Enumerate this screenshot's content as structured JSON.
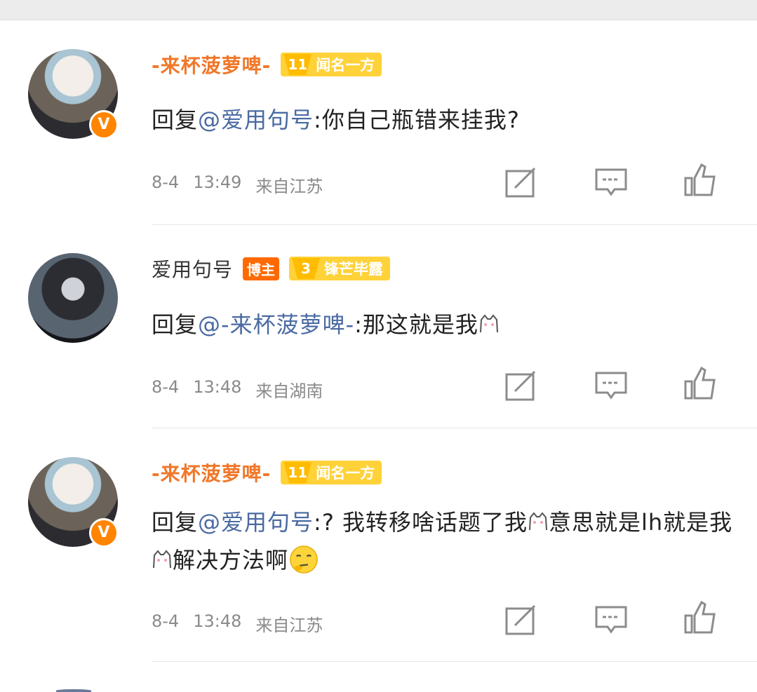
{
  "comments": [
    {
      "username": "-来杯菠萝啤-",
      "level": "11",
      "level_name": "闻名一方",
      "host_tag": "",
      "verified_badge": "V",
      "reply_prefix": "回复",
      "mention": "@爱用句号",
      "text": ":你自己瓶错来挂我?",
      "date": "8-4",
      "time": "13:49",
      "location": "来自江苏"
    },
    {
      "username": "爱用句号",
      "level": "3",
      "level_name": "锋芒毕露",
      "host_tag": "博主",
      "verified_badge": "",
      "reply_prefix": "回复",
      "mention": "@-来杯菠萝啤-",
      "text": ":那这就是我",
      "date": "8-4",
      "time": "13:48",
      "location": "来自湖南"
    },
    {
      "username": "-来杯菠萝啤-",
      "level": "11",
      "level_name": "闻名一方",
      "host_tag": "",
      "verified_badge": "V",
      "reply_prefix": "回复",
      "mention": "@爱用句号",
      "text_part1": ":? 我转移啥话题了我",
      "text_part2": "意思就是lh就是我",
      "text_part3": "解决方法啊",
      "date": "8-4",
      "time": "13:48",
      "location": "来自江苏"
    }
  ],
  "icons": {
    "repost": "repost-icon",
    "comment": "comment-icon",
    "like": "like-icon",
    "emoji_cat": "cat-emoji-icon",
    "emoji_thinking": "thinking-face-icon"
  },
  "colors": {
    "username_orange": "#f0782a",
    "mention_blue": "#4a6aa2",
    "badge_orange": "#ff8400",
    "level_yellow": "#ffd23a",
    "meta_grey": "#8a8a8a"
  }
}
